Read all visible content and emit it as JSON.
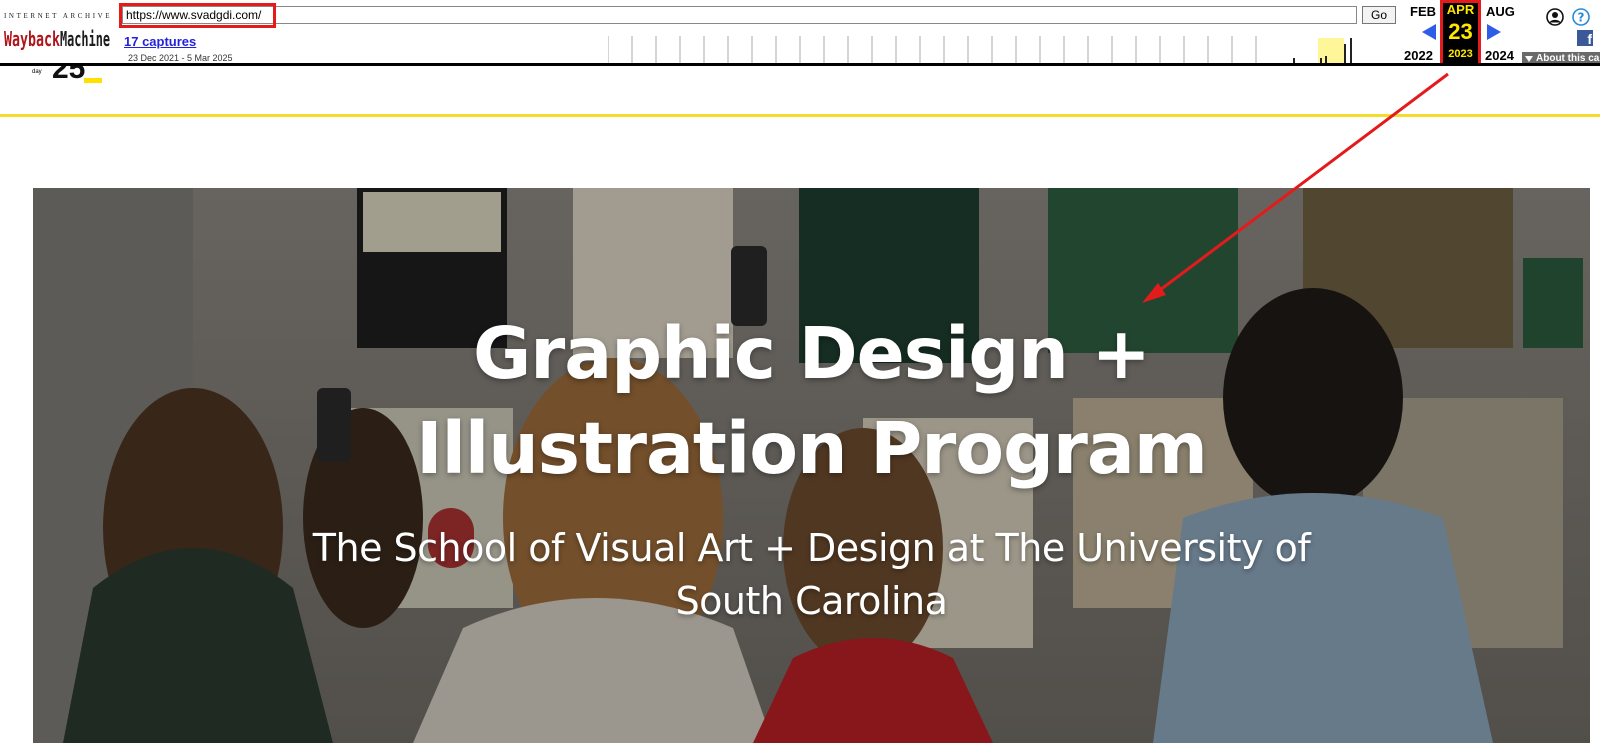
{
  "wayback": {
    "ia_label": "INTERNET ARCHIVE",
    "logo_text": "WaybackMachine",
    "url": "https://www.svadgdi.com/",
    "go_label": "Go",
    "captures_label": "17 captures",
    "date_range": "23 Dec 2021 - 5 Mar 2025",
    "prev_month": "FEB",
    "current_month": "APR",
    "next_month": "AUG",
    "current_day": "23",
    "prev_year": "2022",
    "current_year": "2023",
    "next_year": "2024",
    "about_label": "About this capture",
    "facebook_letter": "f",
    "icons": [
      "user-icon",
      "help-icon",
      "facebook-icon",
      "prev-arrow-icon",
      "next-arrow-icon"
    ]
  },
  "site": {
    "logo_day": "day",
    "logo_number": "25"
  },
  "hero": {
    "title_line1": "Graphic Design +",
    "title_line2": "Illustration Program",
    "subtitle_line1": "The School of Visual Art + Design at The University of",
    "subtitle_line2": "South Carolina"
  },
  "colors": {
    "highlight_red": "#e41b1b",
    "wayback_yellow": "#ffe800",
    "nav_blue": "#2e5ce6",
    "header_rule": "#f5dc2a"
  }
}
